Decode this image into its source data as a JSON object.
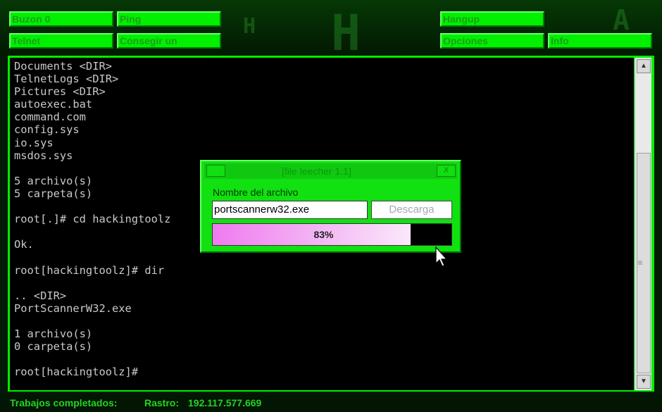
{
  "toolbar": {
    "row1": [
      "Buzon 0",
      "Ping",
      "Hangup"
    ],
    "row2": [
      "Telnet",
      "Consegir un",
      "Opciones",
      "Info"
    ]
  },
  "terminal": {
    "lines": [
      "Documents <DIR>",
      "TelnetLogs <DIR>",
      "Pictures <DIR>",
      "autoexec.bat",
      "command.com",
      "config.sys",
      "io.sys",
      "msdos.sys",
      "",
      "5 archivo(s)",
      "5 carpeta(s)",
      "",
      "root[.]# cd hackingtoolz",
      "",
      "Ok.",
      "",
      "root[hackingtoolz]# dir",
      "",
      ".. <DIR>",
      "PortScannerW32.exe",
      "",
      "1 archivo(s)",
      "0 carpeta(s)",
      "",
      "root[hackingtoolz]#"
    ]
  },
  "status": {
    "completed_label": "Trabajos completados:",
    "trace_label": "Rastro:",
    "trace_value": "192.117.577.669"
  },
  "dialog": {
    "title": "[file leecher 1.1]",
    "close_label": "X",
    "field_label": "Nombre del archivo",
    "filename": "portscannerw32.exe",
    "download_button": "Descarga",
    "progress_percent": 83,
    "progress_text": "83%"
  },
  "background": {
    "glyphs": [
      "H",
      "H",
      "A"
    ]
  },
  "colors": {
    "accent": "#00f000",
    "terminal_bg": "#000000",
    "terminal_text": "#c9c9c9",
    "progress_fill": "#f07af0"
  },
  "icons": [
    "scroll-up-icon",
    "scroll-down-icon",
    "mouse-cursor-icon"
  ]
}
